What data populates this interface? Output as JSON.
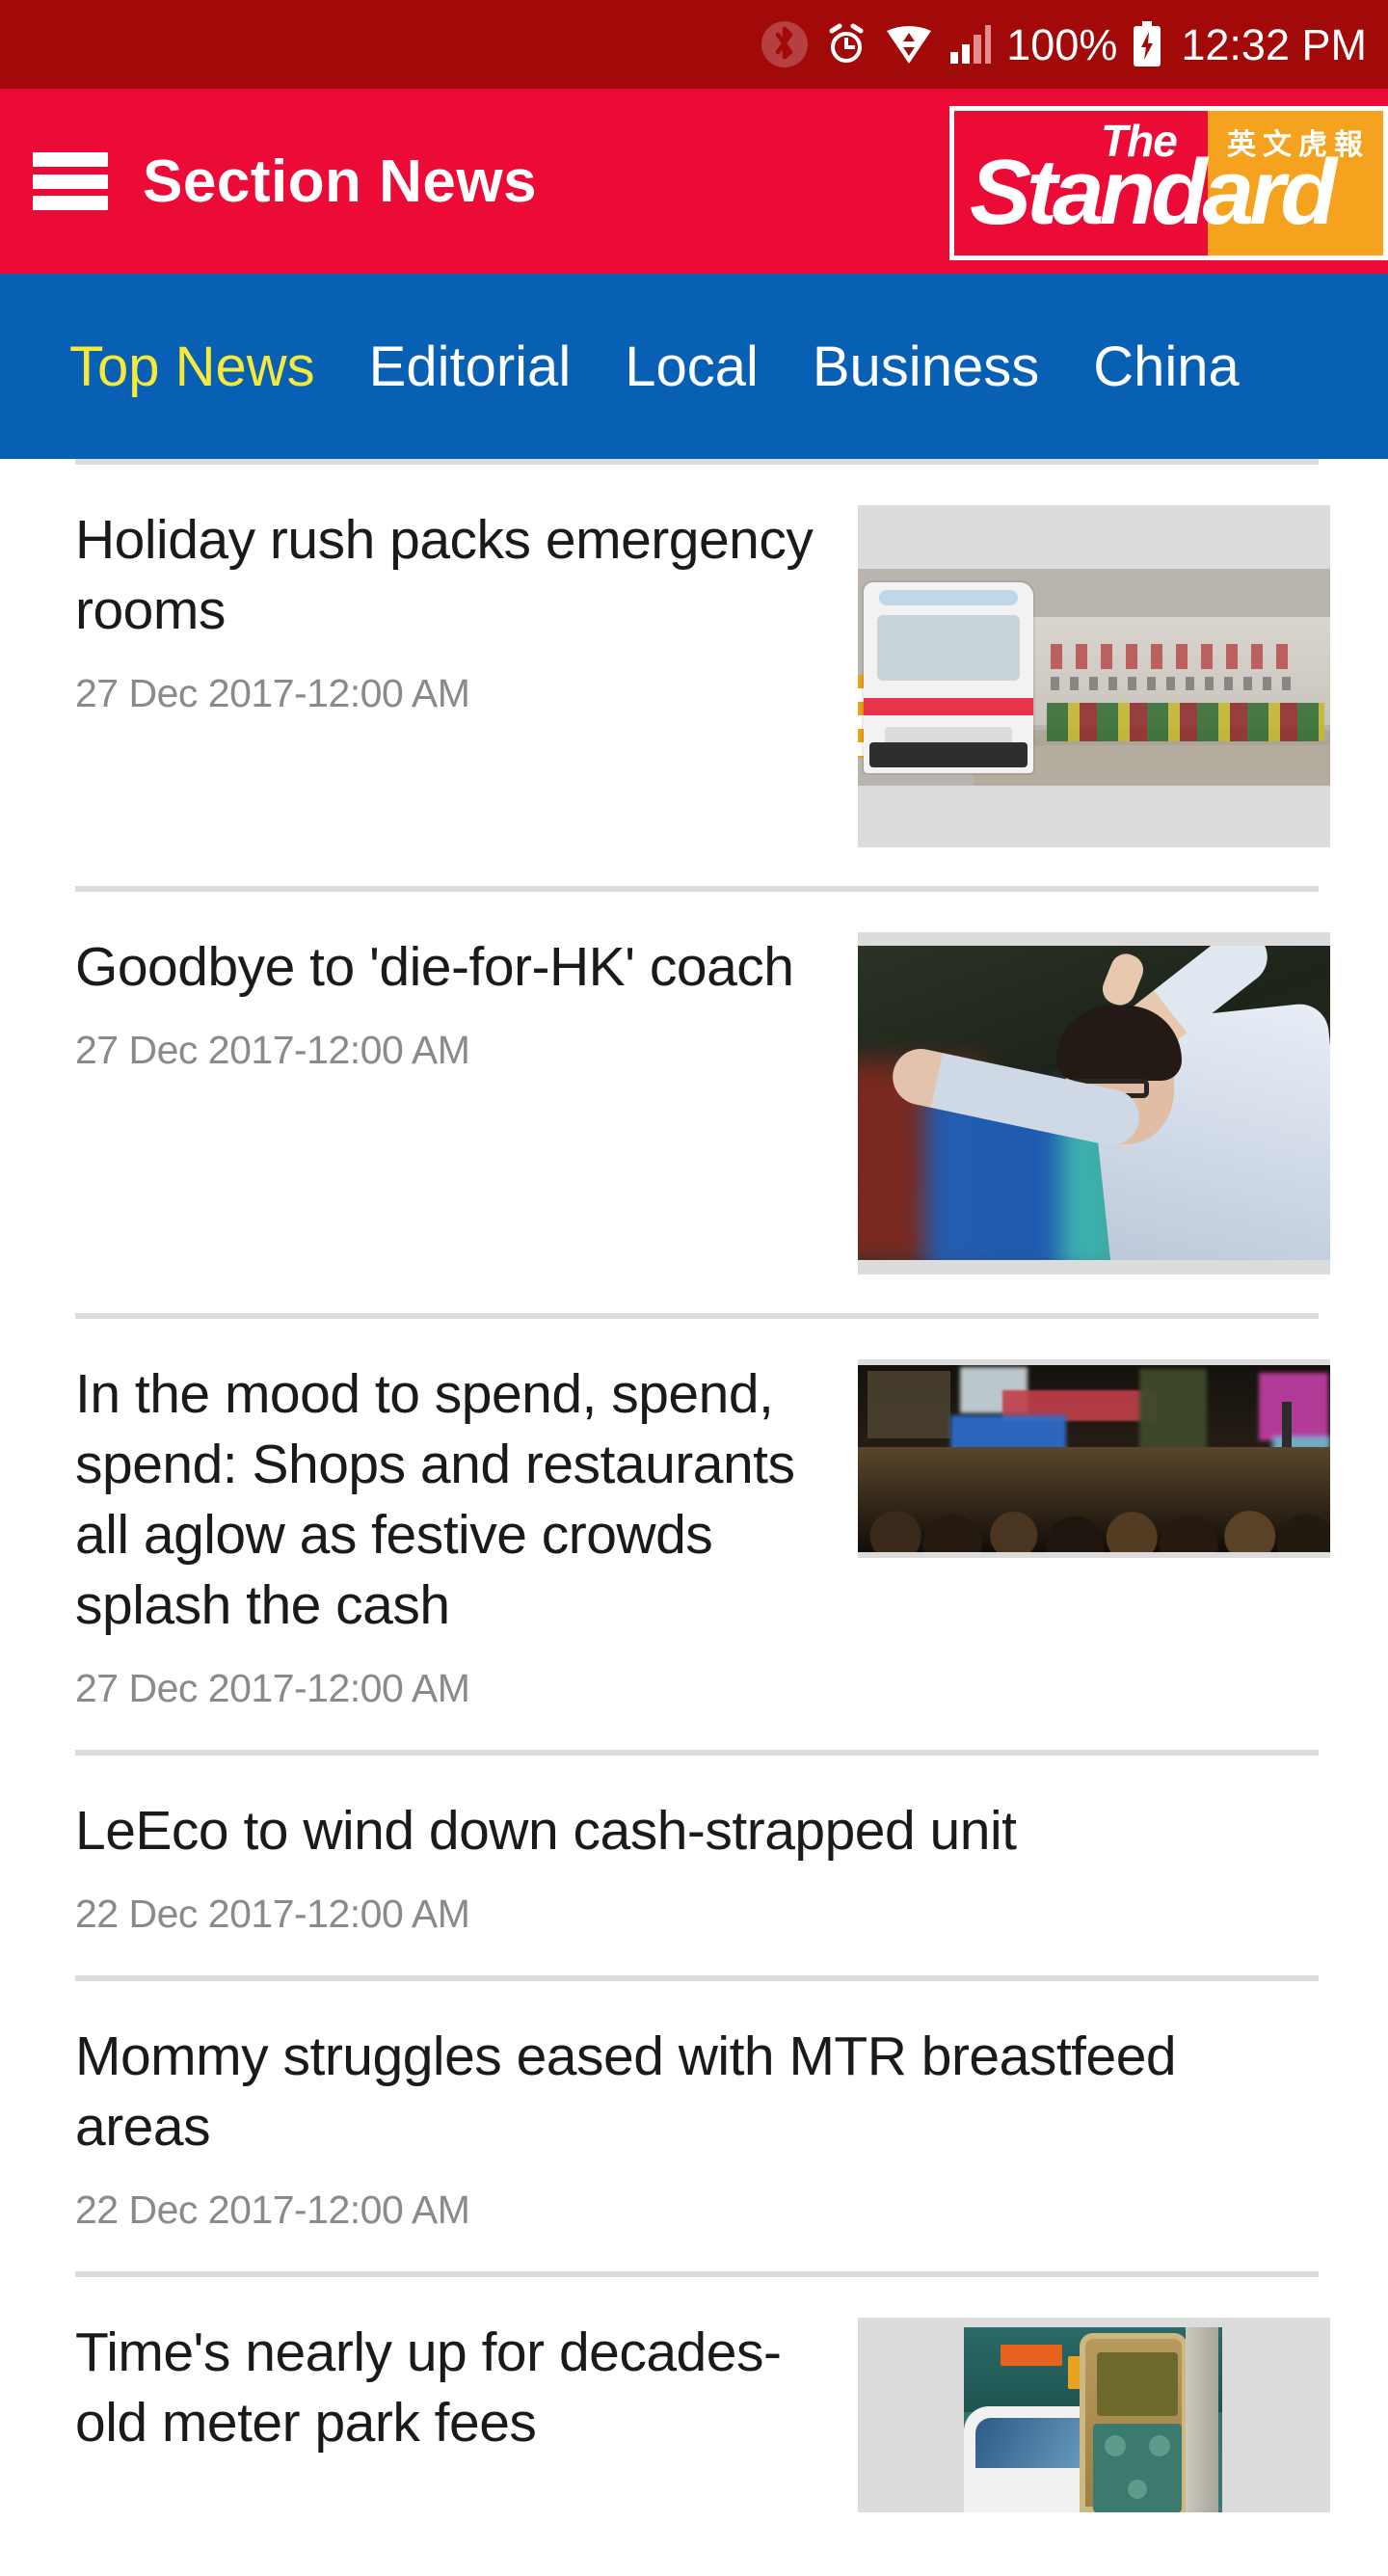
{
  "status_bar": {
    "bluetooth_icon": "bluetooth-icon",
    "alarm_icon": "alarm-clock-icon",
    "wifi_icon": "wifi-data-transfer-icon",
    "signal_icon": "cellular-signal-icon",
    "battery_percent": "100%",
    "battery_icon": "battery-charging-icon",
    "time": "12:32 PM",
    "background": "#A20A0A"
  },
  "header": {
    "menu_icon": "hamburger-menu-icon",
    "title": "Section News",
    "background": "#EC0A37",
    "logo": {
      "the": "The",
      "standard": "Standard",
      "chinese": "英文虎報",
      "left_color": "#EC0A37",
      "right_color": "#F5A21E"
    }
  },
  "tabs": {
    "background": "#0860B4",
    "active_color": "#F5E93A",
    "items": [
      {
        "label": "Top News",
        "active": true
      },
      {
        "label": "Editorial",
        "active": false
      },
      {
        "label": "Local",
        "active": false
      },
      {
        "label": "Business",
        "active": false
      },
      {
        "label": "China",
        "active": false
      }
    ]
  },
  "news": [
    {
      "title": "Holiday rush packs emergency rooms",
      "date": "27 Dec 2017-12:00 AM",
      "thumb": "ambulance-outside-tuen-mun-hospital"
    },
    {
      "title": "Goodbye to 'die-for-HK' coach",
      "date": "27 Dec 2017-12:00 AM",
      "thumb": "football-coach-gesturing"
    },
    {
      "title": "In the mood to spend, spend, spend: Shops and restaurants all aglow as festive crowds splash the cash",
      "date": "27 Dec 2017-12:00 AM",
      "thumb": "night-street-crowd"
    },
    {
      "title": "LeEco to wind down cash-strapped unit",
      "date": "22 Dec 2017-12:00 AM",
      "thumb": null
    },
    {
      "title": "Mommy struggles eased with MTR breastfeed areas",
      "date": "22 Dec 2017-12:00 AM",
      "thumb": null
    },
    {
      "title": "Time's nearly up for decades-old meter park fees",
      "date": "",
      "thumb": "parking-meter-street"
    }
  ]
}
